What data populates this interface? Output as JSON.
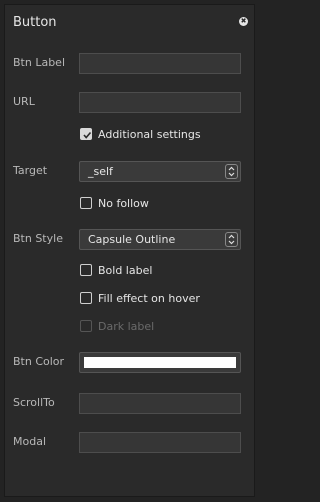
{
  "panel": {
    "title": "Button",
    "close_icon_glyph": "✖"
  },
  "fields": {
    "btn_label": {
      "label": "Btn Label",
      "value": ""
    },
    "url": {
      "label": "URL",
      "value": ""
    },
    "additional_settings": {
      "label": "Additional settings",
      "checked": true
    },
    "target": {
      "label": "Target",
      "value": "_self"
    },
    "no_follow": {
      "label": "No follow",
      "checked": false
    },
    "btn_style": {
      "label": "Btn Style",
      "value": "Capsule Outline"
    },
    "bold_label": {
      "label": "Bold label",
      "checked": false
    },
    "fill_effect": {
      "label": "Fill effect on hover",
      "checked": false
    },
    "dark_label": {
      "label": "Dark label",
      "checked": false,
      "disabled": true
    },
    "btn_color": {
      "label": "Btn Color",
      "color": "#ffffff"
    },
    "scroll_to": {
      "label": "ScrollTo",
      "value": ""
    },
    "modal": {
      "label": "Modal",
      "value": ""
    }
  }
}
